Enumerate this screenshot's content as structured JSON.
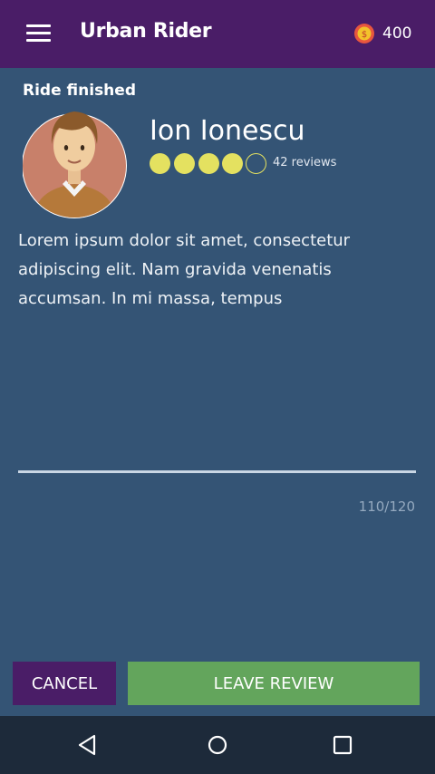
{
  "appbar": {
    "title": "Urban Rider",
    "menu_icon": "hamburger-menu-icon",
    "coin_icon": "coin-icon",
    "coins": "400"
  },
  "ride": {
    "status": "Ride finished"
  },
  "driver": {
    "name": "Ion Ionescu",
    "avatar_icon": "driver-avatar-icon",
    "rating": 4,
    "rating_max": 5,
    "reviews": "42 reviews"
  },
  "review": {
    "text": "Lorem ipsum dolor sit amet, consectetur adipiscing elit. Nam gravida venenatis accumsan. In mi massa, tempus",
    "counter": "110/120"
  },
  "actions": {
    "cancel_label": "CANCEL",
    "leave_review_label": "LEAVE REVIEW"
  },
  "system_nav": {
    "back_icon": "back-icon",
    "home_icon": "home-icon",
    "recents_icon": "recents-icon"
  },
  "colors": {
    "background": "#345475",
    "appbar": "#4a1d67",
    "accent_green": "#63a55c",
    "star_yellow": "#e4e160"
  }
}
